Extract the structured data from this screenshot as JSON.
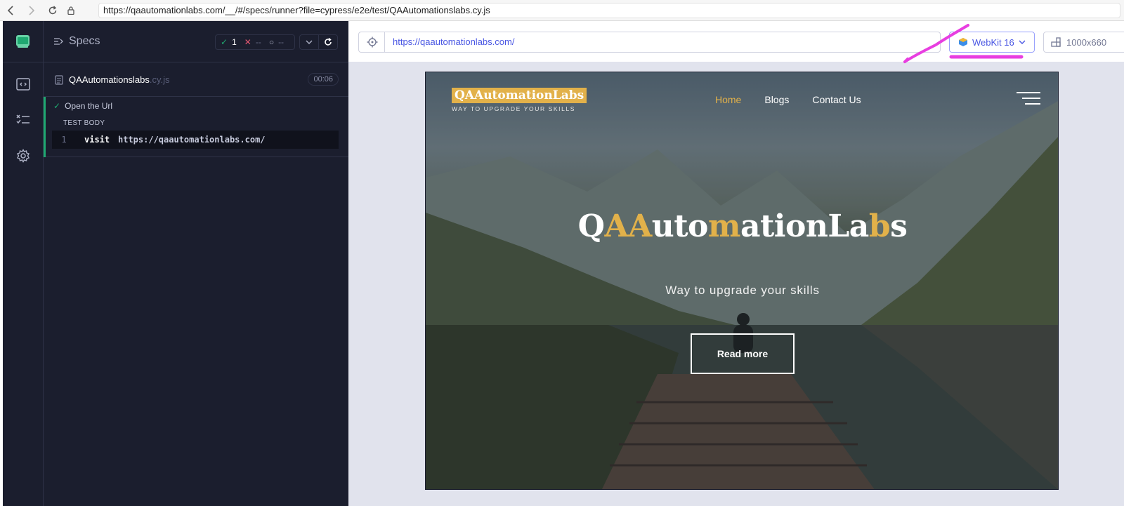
{
  "browser": {
    "address": "https://qaautomationlabs.com/__/#/specs/runner?file=cypress/e2e/test/QAAutomationslabs.cy.js",
    "icons": [
      "back-icon",
      "forward-icon",
      "reload-icon",
      "lock-icon"
    ]
  },
  "sidebar": {
    "icons": [
      "cypress-logo-icon",
      "specs-list-icon",
      "runs-icon",
      "settings-icon"
    ]
  },
  "reporter": {
    "title": "Specs",
    "stats": {
      "passed": "1",
      "failed": "--",
      "pending": "--"
    },
    "spec": {
      "name": "QAAutomationslabs",
      "ext": ".cy.js",
      "duration": "00:06"
    },
    "test": {
      "title": "Open the Url",
      "body_label": "TEST BODY",
      "command": {
        "num": "1",
        "name": "visit",
        "message": "https://qaautomationlabs.com/"
      }
    }
  },
  "aut": {
    "url": "https://qaautomationlabs.com/",
    "browser_label": "WebKit 16",
    "viewport_label": "1000x660",
    "annotation_color": "#e83ee0"
  },
  "site": {
    "brand_name": "QAAutomationLabs",
    "brand_tagline": "WAY TO UPGRADE YOUR SKILLS",
    "nav": [
      "Home",
      "Blogs",
      "Contact Us"
    ],
    "hero_title_parts": [
      "Q",
      "AA",
      "uto",
      "m",
      "ationLa",
      "b",
      "s"
    ],
    "hero_subtitle": "Way to upgrade your skills",
    "cta": "Read more",
    "accent": "#e2b14a"
  }
}
